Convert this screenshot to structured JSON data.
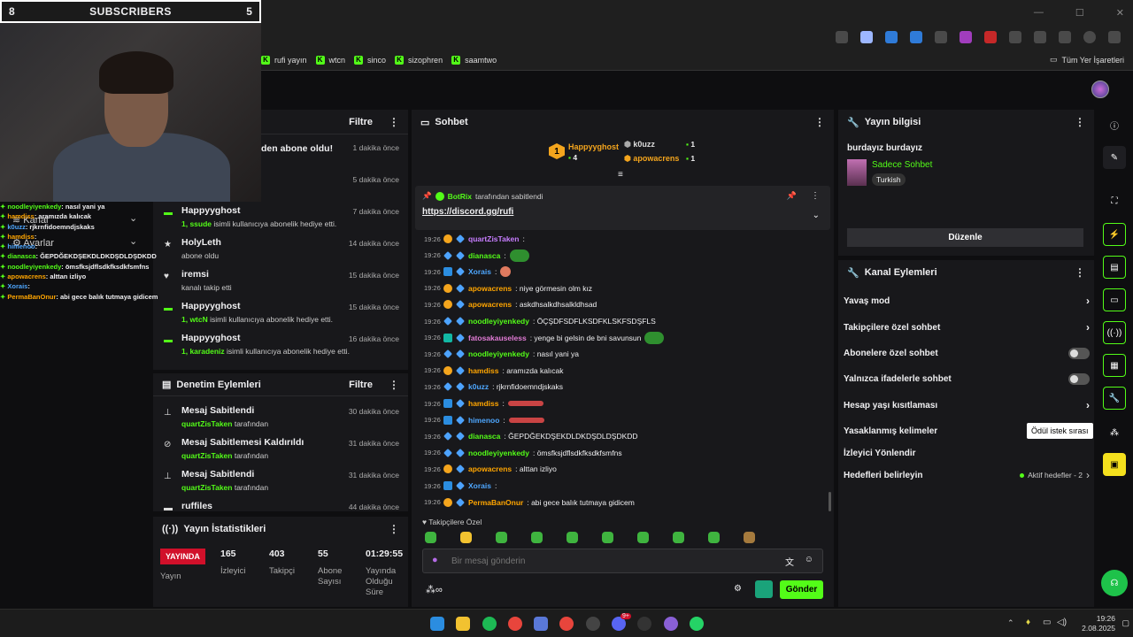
{
  "overlay": {
    "sub_left": "8",
    "sub_title": "SUBSCRIBERS",
    "sub_right": "5",
    "menu_kanal": "Kanal",
    "menu_ayarlar": "Ayarlar",
    "chat": [
      {
        "u": "noodleyiyenkedy",
        "m": ": nasıl yani ya",
        "c": "g"
      },
      {
        "u": "hamdiss",
        "m": ": aramızda kalıcak",
        "c": "o"
      },
      {
        "u": "k0uzz",
        "m": ": rjkrnfidoemndjskaks",
        "c": "b"
      },
      {
        "u": "hamdiss",
        "m": ":",
        "c": "o"
      },
      {
        "u": "himenoo",
        "m": ":",
        "c": "b"
      },
      {
        "u": "dianasca",
        "m": ": ĞEPDĞEKDŞEKDLDKDŞDLDŞDKDD",
        "c": "g"
      },
      {
        "u": "noodleyiyenkedy",
        "m": ": ömsfksjdflsdkfksdkfsmfns",
        "c": "g"
      },
      {
        "u": "apowacrens",
        "m": ": alttan izliyo",
        "c": "o"
      },
      {
        "u": "Xorais",
        "m": ":",
        "c": "b"
      },
      {
        "u": "PermaBanOnur",
        "m": ": abi gece balık tutmaya gidicem",
        "c": "o"
      }
    ]
  },
  "bookmarks": [
    "rufi yayın",
    "wtcn",
    "sinco",
    "sizophren",
    "saamtwo"
  ],
  "bookmarks_all": "Tüm Yer İşaretleri",
  "activity": {
    "filter": "Filtre",
    "first_partial": "den abone oldu!",
    "first_time": "1 dakika önce",
    "second_time": "5 dakika önce",
    "items": [
      {
        "t": "Happyyghost",
        "g": "1, ssude",
        "s": " isimli kullanıcıya abonelik hediye etti.",
        "tm": "7 dakika önce",
        "ic": "gift"
      },
      {
        "t": "HolyLeth",
        "g": "",
        "s": "abone oldu",
        "tm": "14 dakika önce",
        "ic": "star"
      },
      {
        "t": "iremsi",
        "g": "",
        "s": "kanalı takip etti",
        "tm": "15 dakika önce",
        "ic": "heart"
      },
      {
        "t": "Happyyghost",
        "g": "1, wtcN",
        "s": " isimli kullanıcıya abonelik hediye etti.",
        "tm": "15 dakika önce",
        "ic": "gift"
      },
      {
        "t": "Happyyghost",
        "g": "1, karadeniz",
        "s": " isimli kullanıcıya abonelik hediye etti.",
        "tm": "16 dakika önce",
        "ic": "gift"
      }
    ]
  },
  "moderation": {
    "title": "Denetim Eylemleri",
    "filter": "Filtre",
    "items": [
      {
        "t": "Mesaj Sabitlendi",
        "g": "quartZisTaken",
        "s": " tarafından",
        "tm": "30 dakika önce"
      },
      {
        "t": "Mesaj Sabitlemesi Kaldırıldı",
        "g": "quartZisTaken",
        "s": " tarafından",
        "tm": "31 dakika önce"
      },
      {
        "t": "Mesaj Sabitlendi",
        "g": "quartZisTaken",
        "s": " tarafından",
        "tm": "31 dakika önce"
      },
      {
        "t": "ruffiles",
        "g": "",
        "s": "",
        "tm": "44 dakika önce"
      }
    ]
  },
  "stats": {
    "title": "Yayın İstatistikleri",
    "live": "YAYINDA",
    "live_label": "Yayın",
    "viewers": "165",
    "viewers_label": "İzleyici",
    "followers": "403",
    "followers_label": "Takipçi",
    "subs": "55",
    "subs_label": "Abone Sayısı",
    "duration": "01:29:55",
    "duration_label": "Yayında Olduğu Süre"
  },
  "chat": {
    "title": "Sohbet",
    "top1_name": "Happyyghost",
    "top1_count": "4",
    "top1_rank": "1",
    "top2_name": "k0uzz",
    "top2_count": "1",
    "top3_name": "apowacrens",
    "top3_count": "1",
    "pinned_by_user": "BotRix",
    "pinned_by_suffix": "tarafından sabitlendi",
    "pinned_link": "https://discord.gg/rufi",
    "messages": [
      {
        "tm": "19:26",
        "u": "quartZisTaken",
        "m": ":",
        "col": "#c77dff",
        "b": "gold"
      },
      {
        "tm": "19:26",
        "u": "dianasca",
        "m": ":",
        "col": "#53fc18",
        "b": "gem",
        "emote": "green"
      },
      {
        "tm": "19:26",
        "u": "Xorais",
        "m": ":",
        "col": "#4ea7ff",
        "b": "blue",
        "emote": "pink"
      },
      {
        "tm": "19:26",
        "u": "apowacrens",
        "m": ": niye görmesin olm kız",
        "col": "#ffa500",
        "b": "gold"
      },
      {
        "tm": "19:26",
        "u": "apowacrens",
        "m": ": askdhsalkdhsalkldhsad",
        "col": "#ffa500",
        "b": "gold"
      },
      {
        "tm": "19:26",
        "u": "noodleyiyenkedy",
        "m": ": ÖÇŞDFSDFLKSDFKLSKFSDŞFLS",
        "col": "#53fc18",
        "b": "gem"
      },
      {
        "tm": "19:26",
        "u": "fatosakauseless",
        "m": ": yenge bi gelsin de bni savunsun",
        "col": "#e27bd6",
        "b": "teal",
        "emote": "green"
      },
      {
        "tm": "19:26",
        "u": "noodleyiyenkedy",
        "m": ": nasıl yani ya",
        "col": "#53fc18",
        "b": "gem"
      },
      {
        "tm": "19:26",
        "u": "hamdiss",
        "m": ": aramızda kalıcak",
        "col": "#ffa500",
        "b": "gold"
      },
      {
        "tm": "19:26",
        "u": "k0uzz",
        "m": ": rjkrnfidoemndjskaks",
        "col": "#4ea7ff",
        "b": "gem"
      },
      {
        "tm": "19:26",
        "u": "hamdiss",
        "m": ":",
        "col": "#ffa500",
        "b": "blue",
        "emote": "wide"
      },
      {
        "tm": "19:26",
        "u": "himenoo",
        "m": ":",
        "col": "#4ea7ff",
        "b": "blue",
        "emote": "wide"
      },
      {
        "tm": "19:26",
        "u": "dianasca",
        "m": ": ĞEPDĞEKDŞEKDLDKDŞDLDŞDKDD",
        "col": "#53fc18",
        "b": "gem"
      },
      {
        "tm": "19:26",
        "u": "noodleyiyenkedy",
        "m": ": ömsfksjdflsdkfksdkfsmfns",
        "col": "#53fc18",
        "b": "gem"
      },
      {
        "tm": "19:26",
        "u": "apowacrens",
        "m": ": alttan izliyo",
        "col": "#ffa500",
        "b": "gold"
      },
      {
        "tm": "19:26",
        "u": "Xorais",
        "m": ":",
        "col": "#4ea7ff",
        "b": "blue"
      },
      {
        "tm": "19:26",
        "u": "PermaBanOnur",
        "m": ": abi gece balık tutmaya gidicem",
        "col": "#ffa500",
        "b": "gold"
      }
    ],
    "followers_only": "Takipçilere Özel",
    "input_placeholder": "Bir mesaj gönderin",
    "send": "Gönder"
  },
  "stream_info": {
    "title": "Yayın bilgisi",
    "stream_title": "burdayız burdayız",
    "category": "Sadece Sohbet",
    "tag": "Turkish",
    "edit": "Düzenle"
  },
  "channel_actions": {
    "title": "Kanal Eylemleri",
    "items": [
      {
        "label": "Yavaş mod",
        "kind": "arrow"
      },
      {
        "label": "Takipçilere özel sohbet",
        "kind": "arrow"
      },
      {
        "label": "Abonelere özel sohbet",
        "kind": "toggle"
      },
      {
        "label": "Yalnızca ifadelerle sohbet",
        "kind": "toggle"
      },
      {
        "label": "Hesap yaşı kısıtlaması",
        "kind": "arrow"
      },
      {
        "label": "Yasaklanmış kelimeler",
        "kind": "none"
      },
      {
        "label": "İzleyici Yönlendir",
        "kind": "none"
      },
      {
        "label": "Hedefleri belirleyin",
        "kind": "goal"
      }
    ],
    "goal_status": "Aktif hedefler - 2",
    "tooltip": "Ödül istek sırası"
  },
  "taskbar": {
    "time": "19:26",
    "date": "2.08.2025",
    "badge": "9+"
  }
}
